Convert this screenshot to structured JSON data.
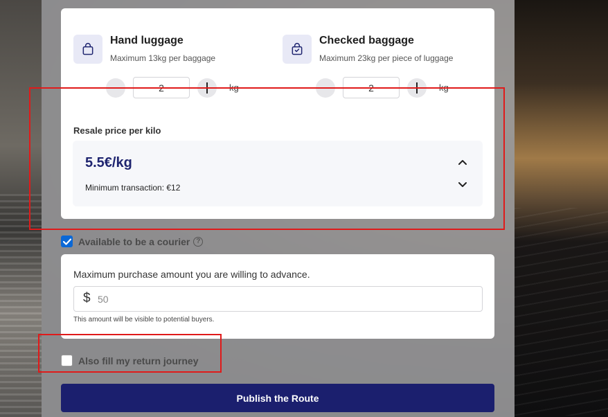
{
  "luggage": {
    "hand": {
      "title": "Hand luggage",
      "subtitle": "Maximum 13kg per baggage",
      "value": "2",
      "unit": "kg",
      "icon": "shopping-bag-icon"
    },
    "checked": {
      "title": "Checked baggage",
      "subtitle": "Maximum 23kg per piece of luggage",
      "value": "2",
      "unit": "kg",
      "icon": "bag-check-icon"
    }
  },
  "resale": {
    "label": "Resale price per kilo",
    "price": "5.5€/kg",
    "minimum": "Minimum transaction: €12"
  },
  "courier": {
    "checkbox_label": "Available to be a courier",
    "checked": true,
    "max_label": "Maximum purchase amount you are willing to advance.",
    "currency_symbol": "$",
    "amount_placeholder": "50",
    "note": "This amount will be visible to potential buyers."
  },
  "return_journey": {
    "checkbox_label": "Also fill my return journey",
    "checked": false
  },
  "actions": {
    "publish_label": "Publish the Route"
  },
  "colors": {
    "primary": "#1b1f6e",
    "price_text": "#1f2570",
    "checkbox_checked": "#0b68d6",
    "highlight": "#e01a1a",
    "icon_bg": "#e8e9f6"
  }
}
